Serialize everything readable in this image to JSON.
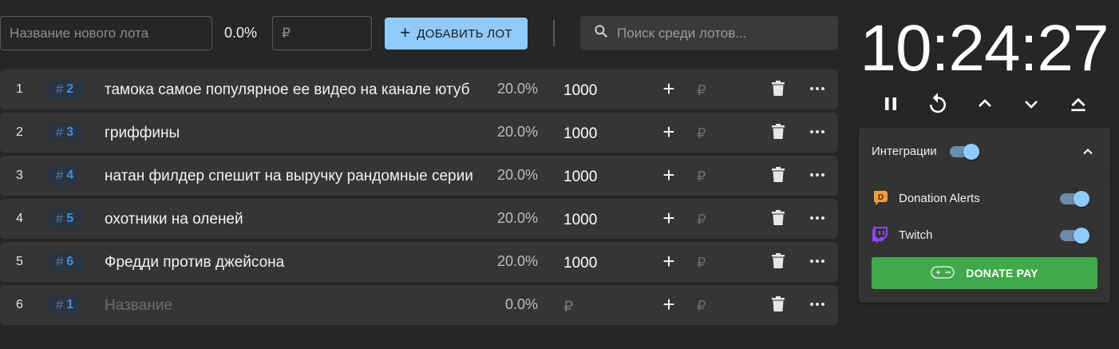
{
  "toolbar": {
    "name_placeholder": "Название нового лота",
    "new_percent": "0.0%",
    "amount_placeholder": "₽",
    "add_button_label": "ДОБАВИТЬ ЛОТ",
    "search_placeholder": "Поиск среди лотов..."
  },
  "lots": [
    {
      "index": "1",
      "id": "2",
      "name": "тамока самое популярное ее видео на канале ютуб",
      "percent": "20.0%",
      "amount": "1000",
      "rub": "₽"
    },
    {
      "index": "2",
      "id": "3",
      "name": "гриффины",
      "percent": "20.0%",
      "amount": "1000",
      "rub": "₽"
    },
    {
      "index": "3",
      "id": "4",
      "name": "натан филдер спешит на выручку рандомные серии",
      "percent": "20.0%",
      "amount": "1000",
      "rub": "₽"
    },
    {
      "index": "4",
      "id": "5",
      "name": "охотники на оленей",
      "percent": "20.0%",
      "amount": "1000",
      "rub": "₽"
    },
    {
      "index": "5",
      "id": "6",
      "name": "Фредди против джейсона",
      "percent": "20.0%",
      "amount": "1000",
      "rub": "₽"
    },
    {
      "index": "6",
      "id": "1",
      "name": "",
      "name_placeholder": "Название",
      "percent": "0.0%",
      "amount": "",
      "amount_placeholder": "₽",
      "rub": "₽"
    }
  ],
  "timer": {
    "display": "10:24:27",
    "controls": [
      "pause-icon",
      "restart-icon",
      "chevron-up-icon",
      "chevron-down-icon",
      "eject-icon"
    ]
  },
  "integrations": {
    "title": "Интеграции",
    "enabled": true,
    "expanded": true,
    "items": [
      {
        "label": "Donation Alerts",
        "icon": "donation-alerts-icon",
        "enabled": true
      },
      {
        "label": "Twitch",
        "icon": "twitch-icon",
        "enabled": true
      }
    ],
    "donatepay_label": "DONATE PAY"
  },
  "colors": {
    "background": "#262626",
    "row": "#353535",
    "accent": "#90caf9",
    "id_text": "#3d8fe6",
    "donatepay": "#3fa94b",
    "donation_alerts": "#f59c3e",
    "twitch": "#9146ff"
  }
}
